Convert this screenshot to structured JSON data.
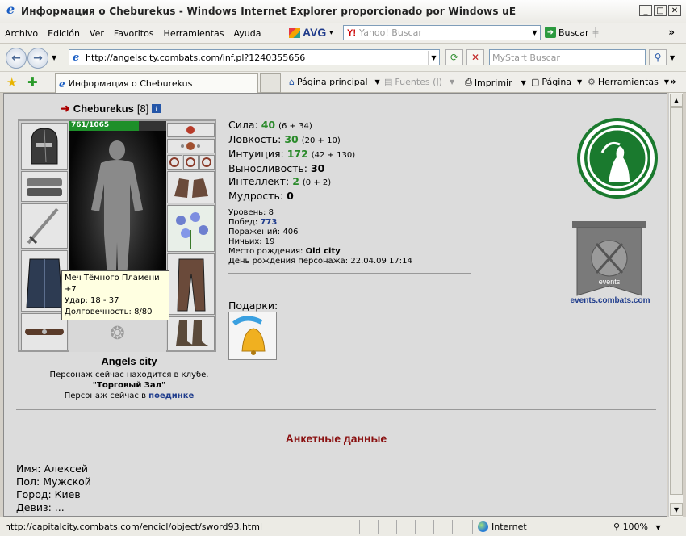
{
  "window": {
    "title": "Информация о Cheburekus - Windows Internet Explorer proporcionado por Windows uE"
  },
  "menu": [
    "Archivo",
    "Edición",
    "Ver",
    "Favoritos",
    "Herramientas",
    "Ayuda"
  ],
  "toolbar": {
    "avg_label": "AVG",
    "search_placeholder": "Yahoo! Buscar",
    "search_button": "Buscar",
    "more": "»"
  },
  "address": {
    "url": "http://angelscity.combats.com/inf.pl?1240355656",
    "mystart_placeholder": "MyStart Buscar"
  },
  "commandbar": {
    "tab_title": "Информация о Cheburekus",
    "home": "Página principal",
    "feeds": "Fuentes (J)",
    "print": "Imprimir",
    "page": "Página",
    "tools": "Herramientas",
    "more": "»"
  },
  "character": {
    "name": "Cheburekus",
    "level_badge": "[8]",
    "hp_text": "761/1065",
    "hp_fraction": 0.715,
    "city": "Angels city",
    "club_line1": "Персонаж сейчас находится в клубе.",
    "club_name": "\"Торговый Зал\"",
    "battle_prefix": "Персонаж сейчас в",
    "battle_link": "поединке"
  },
  "tooltip": {
    "line1": "Меч Тёмного Пламени +7",
    "line2": "Удар: 18 - 37",
    "line3": "Долговечность: 8/80"
  },
  "stats": [
    {
      "label": "Сила:",
      "value": "40",
      "extra": "(6 + 34)",
      "green": true
    },
    {
      "label": "Ловкость:",
      "value": "30",
      "extra": "(20 + 10)",
      "green": true
    },
    {
      "label": "Интуиция:",
      "value": "172",
      "extra": "(42 + 130)",
      "green": true
    },
    {
      "label": "Выносливость:",
      "value": "30",
      "extra": "",
      "green": false
    },
    {
      "label": "Интеллект:",
      "value": "2",
      "extra": "(0 + 2)",
      "green": true
    },
    {
      "label": "Мудрость:",
      "value": "0",
      "extra": "",
      "green": false
    }
  ],
  "info": {
    "level": "Уровень: 8",
    "wins_label": "Побед:",
    "wins": "773",
    "losses": "Поражений: 406",
    "draws": "Ничьих: 19",
    "birthplace_label": "Место рождения:",
    "birthplace": "Old city",
    "birthday": "День рождения персонажа: 22.04.09 17:14"
  },
  "gifts_label": "Подарки:",
  "events": {
    "banner_text": "events",
    "link": "events.combats.com"
  },
  "anketa": {
    "title": "Анкетные данные",
    "name": "Имя: Алексей",
    "gender": "Пол: Мужской",
    "city": "Город: Киев",
    "motto": "Девиз: ..."
  },
  "status": {
    "url": "http://capitalcity.combats.com/encicl/object/sword93.html",
    "zone": "Internet",
    "zoom": "100%"
  }
}
